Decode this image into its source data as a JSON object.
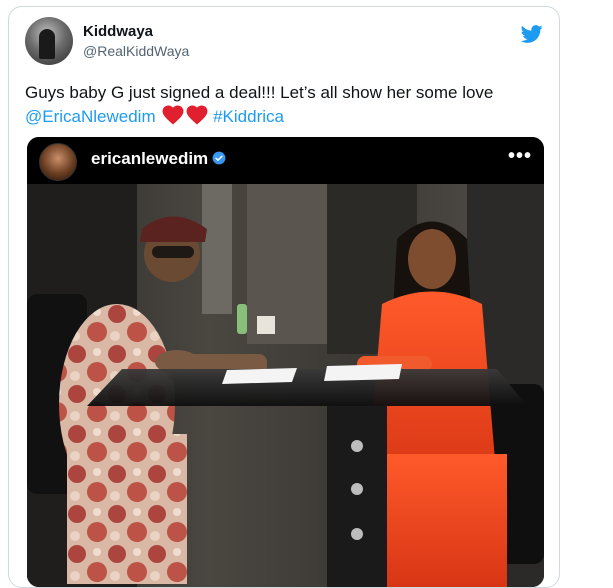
{
  "tweet": {
    "display_name": "Kiddwaya",
    "handle": "@RealKiddWaya",
    "text_main": "Guys baby G just signed a deal!!! Let’s all show her some love",
    "mention": "@EricaNlewedim",
    "hashtag": "#Kiddrica",
    "emoji": [
      "red-heart-icon",
      "red-heart-icon"
    ]
  },
  "embedded_post": {
    "username": "ericanlewedim",
    "verified": true,
    "more_label": "•••"
  },
  "colors": {
    "link": "#1d9bf0",
    "heart": "#e0202e",
    "twitter_blue": "#1d9bf0"
  },
  "icons": {
    "brand": "twitter-bird-icon",
    "verified": "verified-badge-icon",
    "more": "more-options-icon"
  }
}
